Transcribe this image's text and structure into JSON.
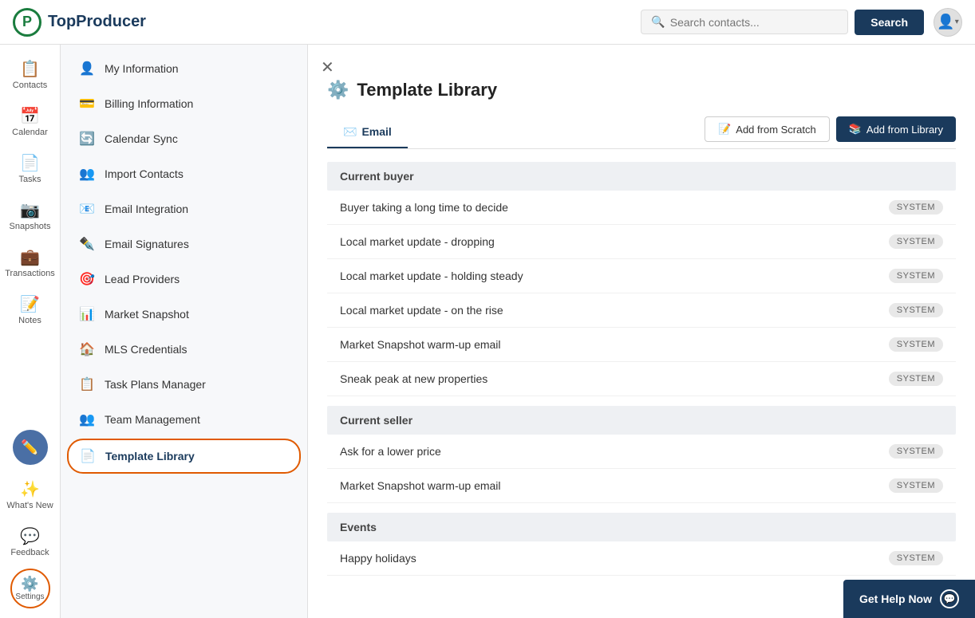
{
  "app": {
    "logo_text": "TopProducer",
    "logo_p": "P"
  },
  "header": {
    "search_placeholder": "Search contacts...",
    "search_button": "Search",
    "user_icon": "👤"
  },
  "left_nav": {
    "items": [
      {
        "id": "contacts",
        "icon": "📋",
        "label": "Contacts"
      },
      {
        "id": "calendar",
        "icon": "📅",
        "label": "Calendar"
      },
      {
        "id": "tasks",
        "icon": "📄",
        "label": "Tasks"
      },
      {
        "id": "snapshots",
        "icon": "📷",
        "label": "Snapshots"
      },
      {
        "id": "transactions",
        "icon": "💼",
        "label": "Transactions"
      },
      {
        "id": "notes",
        "icon": "📝",
        "label": "Notes"
      },
      {
        "id": "whats-new",
        "icon": "✨",
        "label": "What's New"
      },
      {
        "id": "feedback",
        "icon": "💬",
        "label": "Feedback"
      }
    ],
    "edit_icon": "✏️",
    "settings_label": "Settings",
    "settings_icon": "⚙️"
  },
  "sidebar": {
    "items": [
      {
        "id": "my-information",
        "label": "My Information",
        "icon": "👤"
      },
      {
        "id": "billing-information",
        "label": "Billing Information",
        "icon": "💳"
      },
      {
        "id": "calendar-sync",
        "label": "Calendar Sync",
        "icon": "🔄"
      },
      {
        "id": "import-contacts",
        "label": "Import Contacts",
        "icon": "👥"
      },
      {
        "id": "email-integration",
        "label": "Email Integration",
        "icon": "📧"
      },
      {
        "id": "email-signatures",
        "label": "Email Signatures",
        "icon": "✒️"
      },
      {
        "id": "lead-providers",
        "label": "Lead Providers",
        "icon": "🎯"
      },
      {
        "id": "market-snapshot",
        "label": "Market Snapshot",
        "icon": "📊"
      },
      {
        "id": "mls-credentials",
        "label": "MLS Credentials",
        "icon": "🏠"
      },
      {
        "id": "task-plans-manager",
        "label": "Task Plans Manager",
        "icon": "📋"
      },
      {
        "id": "team-management",
        "label": "Team Management",
        "icon": "👥"
      },
      {
        "id": "template-library",
        "label": "Template Library",
        "icon": "📄",
        "active": true
      }
    ]
  },
  "main": {
    "title": "Template Library",
    "title_icon": "⚙️",
    "tabs": [
      {
        "id": "email",
        "label": "Email",
        "icon": "✉️",
        "active": true
      }
    ],
    "add_from_scratch": "Add from Scratch",
    "add_from_library": "Add from Library",
    "sections": [
      {
        "header": "Current buyer",
        "rows": [
          {
            "label": "Buyer taking a long time to decide",
            "badge": "SYSTEM"
          },
          {
            "label": "Local market update - dropping",
            "badge": "SYSTEM"
          },
          {
            "label": "Local market update - holding steady",
            "badge": "SYSTEM"
          },
          {
            "label": "Local market update - on the rise",
            "badge": "SYSTEM"
          },
          {
            "label": "Market Snapshot warm-up email",
            "badge": "SYSTEM"
          },
          {
            "label": "Sneak peak at new properties",
            "badge": "SYSTEM"
          }
        ]
      },
      {
        "header": "Current seller",
        "rows": [
          {
            "label": "Ask for a lower price",
            "badge": "SYSTEM"
          },
          {
            "label": "Market Snapshot warm-up email",
            "badge": "SYSTEM"
          }
        ]
      },
      {
        "header": "Events",
        "rows": [
          {
            "label": "Happy holidays",
            "badge": "SYSTEM"
          }
        ]
      }
    ]
  },
  "help_widget": {
    "label": "Get Help Now",
    "icon": "💬"
  },
  "feedback": {
    "label": "Feedback"
  }
}
